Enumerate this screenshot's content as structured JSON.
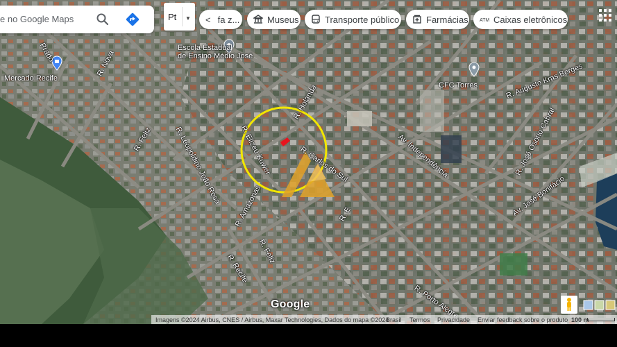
{
  "search": {
    "placeholder": "e no Google Maps",
    "icon": "search-icon",
    "directions_icon": "directions-icon"
  },
  "language": {
    "value": "Pt"
  },
  "chips": [
    {
      "label": "fazer...",
      "display": "fa z...",
      "icon": "chevron-left-icon"
    },
    {
      "label": "Museus",
      "icon": "museum-icon"
    },
    {
      "label": "Transporte público",
      "icon": "bus-icon"
    },
    {
      "label": "Farmácias",
      "icon": "pharmacy-icon"
    },
    {
      "label": "Caixas eletrônicos",
      "icon": "atm-icon"
    }
  ],
  "places": [
    {
      "name_line1": "Escola Estadual",
      "name_line2": "de Ensino Médio José",
      "icon": "school-pin-icon"
    },
    {
      "name": "Mercado Recife",
      "icon": "shopping-pin-icon"
    },
    {
      "name": "CFC Torres",
      "icon": "place-pin-icon"
    }
  ],
  "streets": {
    "nova": "R. Nova",
    "feliz_top": "R. Feliz",
    "leopoldino": "R. Leopoldino João Rosa",
    "elizeu": "R. Elizeu Kuwer",
    "holanda": "R. Holanda",
    "carlos": "R. Carlos do Sul",
    "independencia": "Av. Independência",
    "augusto": "R. Augusto Kras Borges",
    "osorio": "R. José Osório Cabral",
    "bonifacio": "Av. José Bonifácio",
    "amazonas": "R. Amazonas",
    "feliz_bottom": "R. Feliz",
    "recife": "R. Recife",
    "e": "R. E",
    "porto": "R. Porto Alegre",
    "prado": "Prado"
  },
  "brand": {
    "logo": "Google"
  },
  "attribution": {
    "imagery": "Imagens ©2024 Airbus, CNES / Airbus, Maxar Technologies, Dados do mapa ©2024",
    "country": "Brasil",
    "terms": "Termos",
    "privacy": "Privacidade",
    "feedback": "Enviar feedback sobre o produto",
    "scale": "100 m"
  },
  "controls": {
    "pegman": "pegman-icon",
    "layers": "layers-thumbnail",
    "apps": "apps-grid-icon"
  },
  "colors": {
    "highlight_circle": "#f2e600",
    "marker": "#e8141e",
    "watermark": "#e2a32a",
    "directions": "#1a73e8"
  }
}
